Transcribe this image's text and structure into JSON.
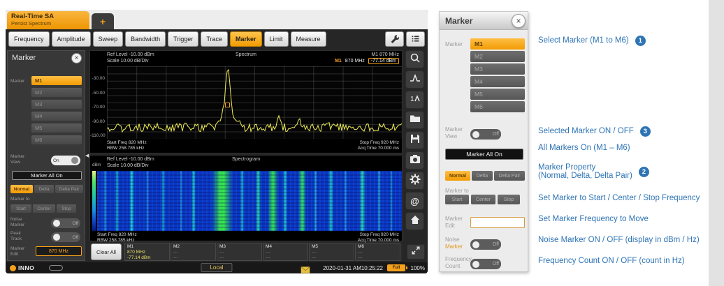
{
  "colors": {
    "accent": "#f5a11c",
    "blue": "#2e74b5",
    "trace": "#f0ed55"
  },
  "window": {
    "tab": {
      "title": "Real-Time SA",
      "subtitle": "Persist Spectrum",
      "new_tab": "+"
    },
    "toolbar": {
      "buttons": [
        "Frequency",
        "Amplitude",
        "Sweep",
        "Bandwidth",
        "Trigger",
        "Trace",
        "Marker",
        "Limit",
        "Measure"
      ],
      "active": "Marker"
    },
    "marker_panel": {
      "title": "Marker",
      "close": "×",
      "marker_label": "Marker",
      "markers": [
        "M1",
        "M2",
        "M3",
        "M4",
        "M5",
        "M6"
      ],
      "selected_marker": "M1",
      "marker_view_label": "Marker View",
      "marker_view_state": "On",
      "marker_all_on_label": "Marker All On",
      "properties": [
        "Normal",
        "Delta",
        "Delta Pair"
      ],
      "active_property": "Normal",
      "marker_to_label": "Marker to",
      "marker_to_buttons": [
        "Start",
        "Center",
        "Stop"
      ],
      "noise_marker_label": "Noise Marker",
      "noise_marker_state": "Off",
      "peak_track_label": "Peak Track",
      "peak_track_state": "Off",
      "marker_edit_label": "Marker Edit",
      "marker_edit_value": "870 MHz",
      "collapse_glyph": "◀"
    },
    "spectrum": {
      "ref_level": "Ref Level -10.00 dBm",
      "scale": "Scale 10.00 dB/Div",
      "title": "Spectrum",
      "marker_title": "M1 870 MHz",
      "marker_label": "M1",
      "marker_freq": "870 MHz",
      "marker_level": "-77.14 dBm",
      "y_ticks": [
        "-30.00",
        "-50.00",
        "-70.00",
        "-90.00",
        "-110.00"
      ],
      "start_freq": "Start Freq 820 MHz",
      "rbw": "RBW 258.785 kHz",
      "stop_freq": "Stop Freq 920 MHz",
      "acq_time": "Acq Time 70.000 ms",
      "numeric": {
        "start_mhz": 820,
        "stop_mhz": 920,
        "ref_dbm": -10,
        "scale_db_per_div": 10,
        "marker_mhz": 870,
        "marker_dbm": -77.14
      }
    },
    "spectrogram": {
      "unit": "dBm",
      "ref_level": "Ref Level -10.00 dBm",
      "scale": "Scale 10.00 dB/Div",
      "title": "Spectrogram",
      "start_freq": "Start Freq 820 MHz",
      "rbw": "RBW 258.785 kHz",
      "stop_freq": "Stop Freq 920 MHz",
      "acq_time": "Acq Time 70.000 ms"
    },
    "side_icons": [
      "peak-search",
      "next-peak",
      "marker-to-trace",
      "open-file",
      "save",
      "screenshot",
      "setup",
      "preset",
      "home"
    ],
    "marker_table": {
      "clear_all_label": "Clear All",
      "rows": [
        {
          "name": "M1",
          "freq": "870 MHz",
          "level": "-77.14 dBm"
        },
        {
          "name": "M2",
          "freq": "---",
          "level": "---"
        },
        {
          "name": "M3",
          "freq": "---",
          "level": "---"
        },
        {
          "name": "M4",
          "freq": "---",
          "level": "---"
        },
        {
          "name": "M5",
          "freq": "---",
          "level": "---"
        },
        {
          "name": "M6",
          "freq": "---",
          "level": "---"
        }
      ]
    },
    "statusbar": {
      "brand": "INNO",
      "local_label": "Local",
      "datetime": "2020-01-31 AM10:25:22",
      "battery_label": "Full",
      "battery_pct": "100%"
    }
  },
  "callout": {
    "title": "Marker",
    "close": "×",
    "marker_label": "Marker",
    "markers": [
      "M1",
      "M2",
      "M3",
      "M4",
      "M5",
      "M6"
    ],
    "selected_marker": "M1",
    "marker_view_label": "Marker View",
    "marker_view_state": "Off",
    "marker_all_on_label": "Marker All On",
    "properties": [
      "Normal",
      "Delta",
      "Delta Pair"
    ],
    "active_property": "Normal",
    "marker_to_label": "Marker to",
    "marker_to_buttons": [
      "Start",
      "Center",
      "Stop"
    ],
    "marker_edit_label": "Marker Edit",
    "marker_edit_value": "",
    "noise_marker_label_1": "Noise",
    "noise_marker_label_2": "Marker",
    "noise_marker_state": "Off",
    "frequency_count_label": "Frequency Count",
    "frequency_count_state": "Off"
  },
  "annotations": [
    {
      "text": "Select Marker (M1 to M6)",
      "badge": "1"
    },
    {
      "text": "Selected Marker ON / OFF",
      "badge": "3"
    },
    {
      "text": "All Markers On (M1 – M6)"
    },
    {
      "text": "Marker Property",
      "text2": "(Normal, Delta, Delta Pair)",
      "badge": "2"
    },
    {
      "text": "Set Marker to Start / Center / Stop Frequency"
    },
    {
      "text": "Set Marker Frequency to Move"
    },
    {
      "text": "Noise Marker ON / OFF (display in dBm / Hz)"
    },
    {
      "text": "Frequency Count ON / OFF (count in Hz)"
    }
  ],
  "spectrogram_stripes": [
    {
      "x": 2,
      "w": 1.2,
      "c": "#1f86d8"
    },
    {
      "x": 6,
      "w": 1.0,
      "c": "#15b0c8"
    },
    {
      "x": 10.5,
      "w": 1.6,
      "c": "#18c8d0"
    },
    {
      "x": 16,
      "w": 1.0,
      "c": "#1f86d8"
    },
    {
      "x": 21,
      "w": 1.2,
      "c": "#15a0d0"
    },
    {
      "x": 27,
      "w": 1.0,
      "c": "#1f86d8"
    },
    {
      "x": 31,
      "w": 1.4,
      "c": "#18c0c8"
    },
    {
      "x": 37.5,
      "w": 7.0,
      "c": "#2ee24e"
    },
    {
      "x": 39.5,
      "w": 3.0,
      "c": "#a8f040"
    },
    {
      "x": 47,
      "w": 1.2,
      "c": "#18b8d0"
    },
    {
      "x": 52,
      "w": 1.6,
      "c": "#20d0a8"
    },
    {
      "x": 56,
      "w": 3.5,
      "c": "#2ad858"
    },
    {
      "x": 61,
      "w": 1.4,
      "c": "#18c0d0"
    },
    {
      "x": 66,
      "w": 2.5,
      "c": "#28d868"
    },
    {
      "x": 71,
      "w": 1.2,
      "c": "#1f96d8"
    },
    {
      "x": 76,
      "w": 1.6,
      "c": "#18c0c8"
    },
    {
      "x": 81,
      "w": 1.0,
      "c": "#1f86d8"
    },
    {
      "x": 86,
      "w": 2.0,
      "c": "#20c8b8"
    },
    {
      "x": 92,
      "w": 1.2,
      "c": "#1f96d8"
    },
    {
      "x": 96,
      "w": 1.0,
      "c": "#1886c8"
    }
  ]
}
